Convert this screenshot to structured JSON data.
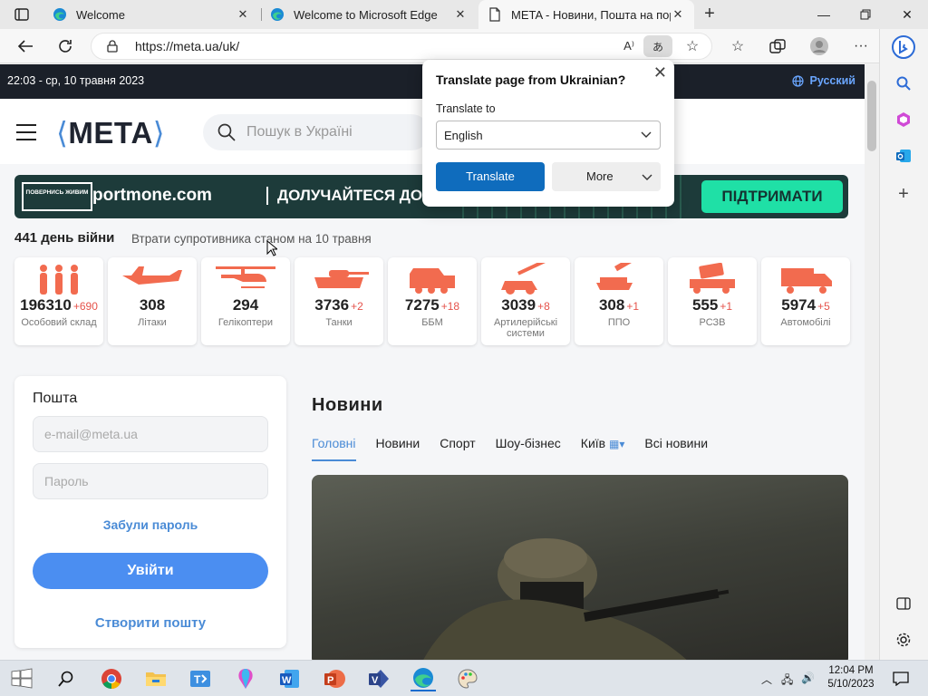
{
  "browser": {
    "tabs": [
      {
        "title": "Welcome",
        "icon": "edge-icon"
      },
      {
        "title": "Welcome to Microsoft Edge",
        "icon": "edge-icon"
      },
      {
        "title": "META - Новини, Пошта на порт",
        "icon": "page-icon",
        "active": true
      }
    ],
    "url": "https://meta.ua/uk/"
  },
  "page": {
    "datetime": "22:03 - ср, 10 травня 2023",
    "language_link": "Русский",
    "logo": "МЕТА",
    "search_placeholder": "Пошук в Україні",
    "banner": {
      "badge": "ПОВЕРНИСЬ ЖИВИМ",
      "brand": "portmone.com",
      "slogan": "ДОЛУЧАЙТЕСЯ ДО ЗБОРУ",
      "button": "ПІДТРИМАТИ"
    },
    "war_day": "441 день війни",
    "losses_caption": "Втрати супротивника станом на 10 травня",
    "stats": [
      {
        "value": "196310",
        "delta": "+690",
        "label": "Особовий склад"
      },
      {
        "value": "308",
        "delta": "",
        "label": "Літаки"
      },
      {
        "value": "294",
        "delta": "",
        "label": "Гелікоптери"
      },
      {
        "value": "3736",
        "delta": "+2",
        "label": "Танки"
      },
      {
        "value": "7275",
        "delta": "+18",
        "label": "ББМ"
      },
      {
        "value": "3039",
        "delta": "+8",
        "label": "Артилерійські системи"
      },
      {
        "value": "308",
        "delta": "+1",
        "label": "ППО"
      },
      {
        "value": "555",
        "delta": "+1",
        "label": "РСЗВ"
      },
      {
        "value": "5974",
        "delta": "+5",
        "label": "Автомобілі"
      }
    ],
    "mail": {
      "title": "Пошта",
      "email_placeholder": "e-mail@meta.ua",
      "password_placeholder": "Пароль",
      "forgot": "Забули пароль",
      "login": "Увійти",
      "create": "Створити пошту"
    },
    "news": {
      "title": "Новини",
      "tabs": [
        "Головні",
        "Новини",
        "Спорт",
        "Шоу-бізнес",
        "Київ",
        "Всі новини"
      ]
    }
  },
  "translate_popup": {
    "title": "Translate page from Ukrainian?",
    "label": "Translate to",
    "selected": "English",
    "translate_button": "Translate",
    "more_button": "More"
  },
  "taskbar": {
    "time": "12:04 PM",
    "date": "5/10/2023"
  },
  "colors": {
    "accent": "#4a8bd6",
    "loss_red": "#f26b4f",
    "edge_blue": "#0f6cbd",
    "support_green": "#1fe0a6"
  }
}
